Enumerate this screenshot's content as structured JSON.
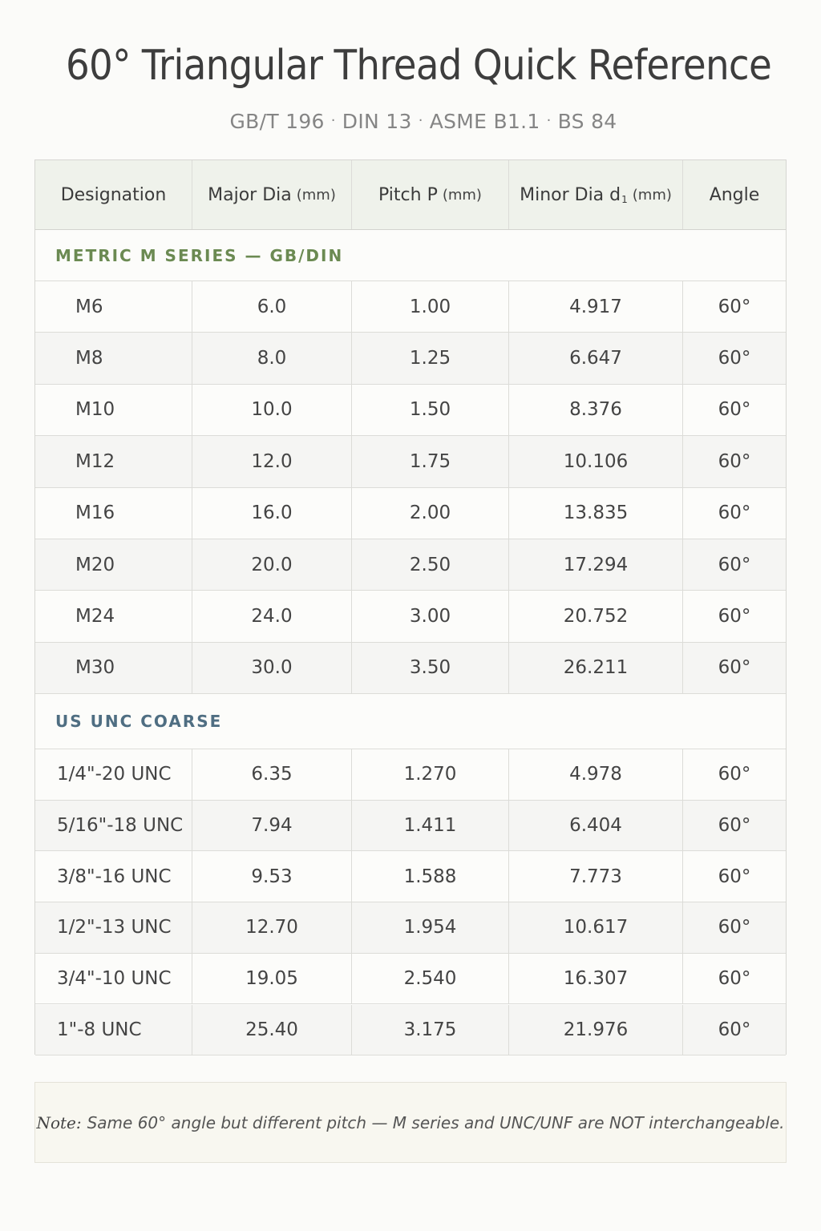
{
  "title": "60° Triangular Thread Quick Reference",
  "standards": [
    "GB/T 196",
    "DIN 13",
    "ASME B1.1",
    "BS 84"
  ],
  "standards_separator": "·",
  "table": {
    "headers": {
      "designation": "Designation",
      "major_dia": "Major Dia",
      "major_dia_unit": "(mm)",
      "pitch": "Pitch P",
      "pitch_unit": "(mm)",
      "minor_dia": "Minor Dia d",
      "minor_dia_subscript": "1",
      "minor_dia_unit": "(mm)",
      "angle": "Angle"
    },
    "metric_section_title": "METRIC M SERIES — GB/DIN",
    "metric_rows": [
      [
        "M6",
        "6.0",
        "1.00",
        "4.917",
        "60°"
      ],
      [
        "M8",
        "8.0",
        "1.25",
        "6.647",
        "60°"
      ],
      [
        "M10",
        "10.0",
        "1.50",
        "8.376",
        "60°"
      ],
      [
        "M12",
        "12.0",
        "1.75",
        "10.106",
        "60°"
      ],
      [
        "M16",
        "16.0",
        "2.00",
        "13.835",
        "60°"
      ],
      [
        "M20",
        "20.0",
        "2.50",
        "17.294",
        "60°"
      ],
      [
        "M24",
        "24.0",
        "3.00",
        "20.752",
        "60°"
      ],
      [
        "M30",
        "30.0",
        "3.50",
        "26.211",
        "60°"
      ]
    ],
    "unc_section_title": "US UNC COARSE",
    "unc_rows": [
      [
        "1/4\"-20 UNC",
        "6.35",
        "1.270",
        "4.978",
        "60°"
      ],
      [
        "5/16\"-18 UNC",
        "7.94",
        "1.411",
        "6.404",
        "60°"
      ],
      [
        "3/8\"-16 UNC",
        "9.53",
        "1.588",
        "7.773",
        "60°"
      ],
      [
        "1/2\"-13 UNC",
        "12.70",
        "1.954",
        "10.617",
        "60°"
      ],
      [
        "3/4\"-10 UNC",
        "19.05",
        "2.540",
        "16.307",
        "60°"
      ],
      [
        "1\"-8 UNC",
        "25.40",
        "3.175",
        "21.976",
        "60°"
      ]
    ]
  },
  "note": {
    "label": "Note:",
    "text": "Same 60° angle but different pitch — M series and UNC/UNF are NOT interchangeable."
  },
  "colors": {
    "metric_accent": "#6b8a52",
    "unc_accent": "#4f6e82",
    "header_bg": "#eff2eb",
    "note_bg": "#f8f7f0"
  }
}
